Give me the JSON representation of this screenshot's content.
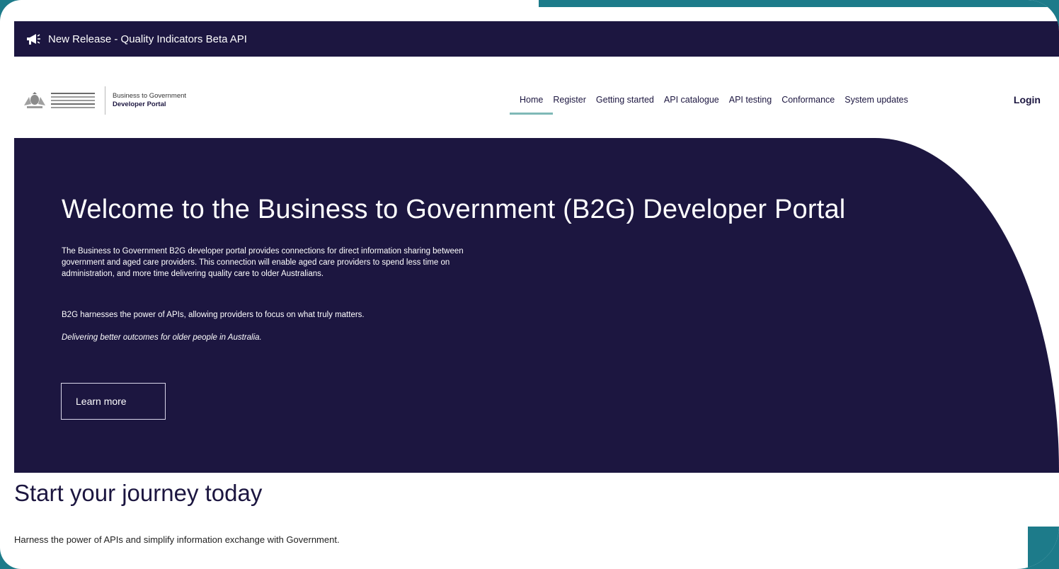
{
  "announcement": {
    "text": "New Release - Quality Indicators Beta API",
    "icon": "megaphone-icon"
  },
  "header": {
    "logo_line1": "Business to Government",
    "logo_line2": "Developer Portal",
    "nav": [
      {
        "label": "Home",
        "active": true
      },
      {
        "label": "Register"
      },
      {
        "label": "Getting started"
      },
      {
        "label": "API catalogue"
      },
      {
        "label": "API testing"
      },
      {
        "label": "Conformance"
      },
      {
        "label": "System updates"
      }
    ],
    "login": "Login"
  },
  "hero": {
    "title": "Welcome to the Business to Government (B2G) Developer Portal",
    "p1": "The Business to Government B2G developer portal provides connections for direct information sharing between government and aged care providers. This connection will enable aged care providers to spend less time on administration, and more time delivering quality care to older Australians.",
    "p2": "B2G harnesses the power of APIs, allowing providers to focus on what truly matters.",
    "p3": "Delivering better outcomes for older people in Australia.",
    "cta": "Learn more"
  },
  "journey": {
    "title": "Start your journey today",
    "text": "Harness the power of APIs and simplify information exchange with Government."
  },
  "colors": {
    "navy": "#1c1640",
    "teal_border": "#1d7b8a",
    "nav_underline": "#7fb9b7"
  }
}
